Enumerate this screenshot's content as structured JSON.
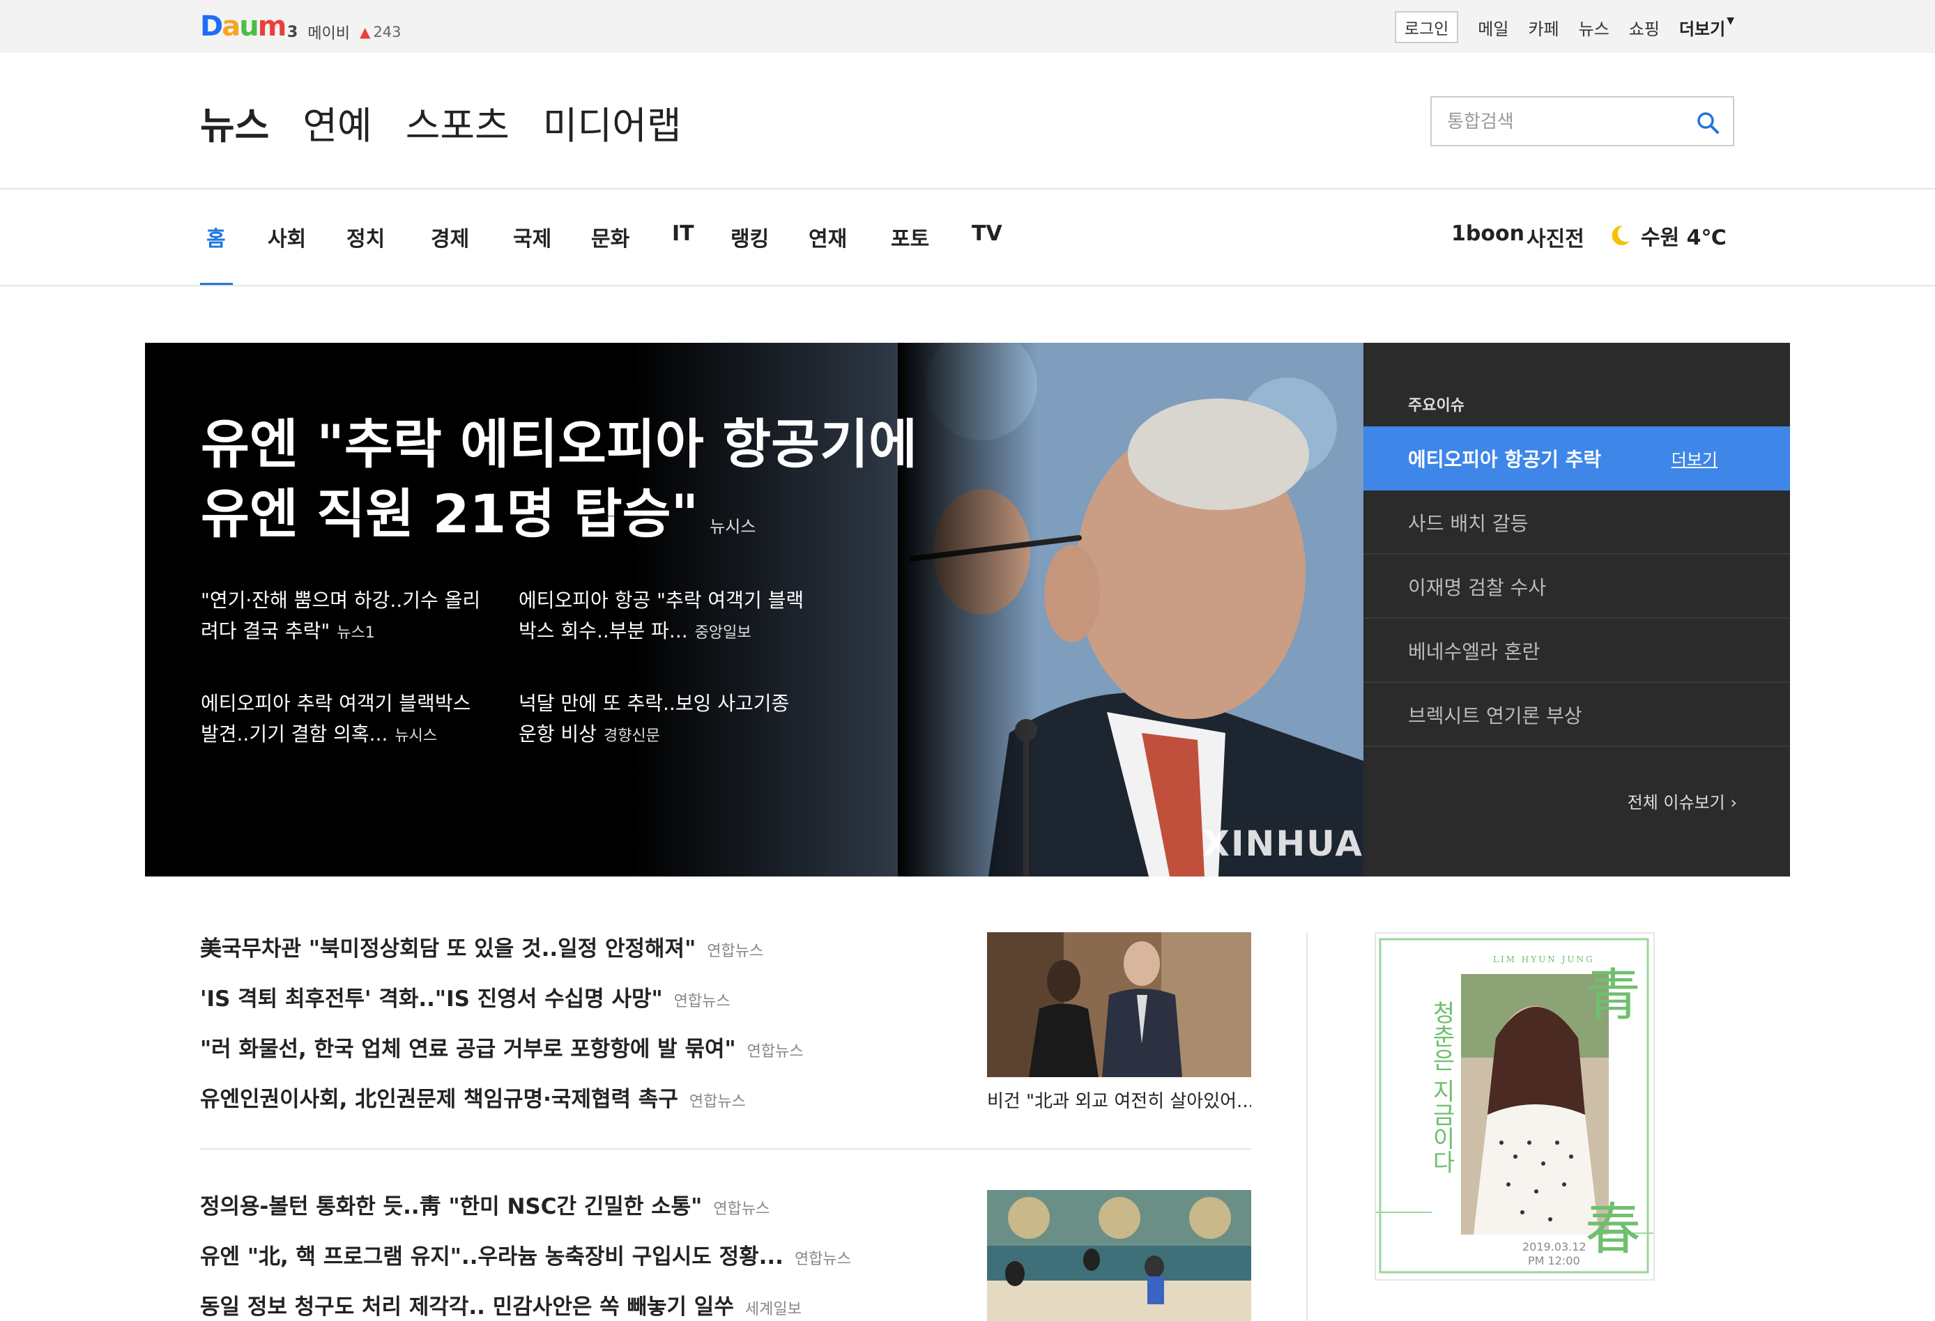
{
  "topbar": {
    "logo_letters": [
      "D",
      "a",
      "u",
      "m"
    ],
    "rank": {
      "number": "3",
      "keyword": "메이비",
      "delta": "243"
    },
    "login": "로그인",
    "links": [
      "메일",
      "카페",
      "뉴스",
      "쇼핑"
    ],
    "more": "더보기"
  },
  "sections": {
    "items": [
      "뉴스",
      "연예",
      "스포츠",
      "미디어랩"
    ],
    "active": "뉴스"
  },
  "search": {
    "placeholder": "통합검색"
  },
  "nav": {
    "categories": [
      "홈",
      "사회",
      "정치",
      "경제",
      "국제",
      "문화",
      "IT",
      "랭킹",
      "연재",
      "포토",
      "TV"
    ],
    "active": "홈",
    "right_links": [
      "1boon",
      "사진전"
    ],
    "weather": "수원 4℃"
  },
  "hero": {
    "title": "유엔 \"추락 에티오피아 항공기에 유엔 직원 21명 탑승\"",
    "title_source": "뉴시스",
    "subs": [
      {
        "text": "\"연기·잔해 뿜으며 하강..기수 올리려다 결국 추락\"",
        "source": "뉴스1"
      },
      {
        "text": "에티오피아 항공 \"추락 여객기 블랙박스 회수..부분 파...",
        "source": "중앙일보"
      },
      {
        "text": "에티오피아 추락 여객기 블랙박스 발견..기기 결함 의혹...",
        "source": "뉴시스"
      },
      {
        "text": "넉달 만에 또 추락..보잉 사고기종 운항 비상",
        "source": "경향신문"
      }
    ],
    "watermark": "XINHUA"
  },
  "issues": {
    "heading": "주요이슈",
    "items": [
      "에티오피아 항공기 추락",
      "사드 배치 갈등",
      "이재명 검찰 수사",
      "베네수엘라 혼란",
      "브렉시트 연기론 부상"
    ],
    "more": "더보기",
    "all": "전체 이슈보기"
  },
  "news": {
    "group1": [
      {
        "text": "美국무차관 \"북미정상회담 또 있을 것..일정 안정해져\"",
        "source": "연합뉴스"
      },
      {
        "text": "'IS 격퇴 최후전투' 격화..\"IS 진영서 수십명 사망\"",
        "source": "연합뉴스"
      },
      {
        "text": "\"러 화물선, 한국 업체 연료 공급 거부로 포항항에 발 묶여\"",
        "source": "연합뉴스"
      },
      {
        "text": "유엔인권이사회, 北인권문제 책임규명·국제협력 촉구",
        "source": "연합뉴스"
      }
    ],
    "group2": [
      {
        "text": "정의용-볼턴 통화한 듯..靑 \"한미 NSC간 긴밀한 소통\"",
        "source": "연합뉴스"
      },
      {
        "text": "유엔 \"北, 핵 프로그램 유지\"..우라늄 농축장비 구입시도 정황...",
        "source": "연합뉴스"
      },
      {
        "text": "동일 정보 청구도 처리 제각각.. 민감사안은 쏙 빼놓기 일쑤",
        "source": "세계일보"
      }
    ],
    "thumb_caption": "비건 \"北과 외교 여전히 살아있어...\""
  },
  "ad": {
    "top": "LIM HYUN JUNG",
    "vertical": "청춘은 지금이다",
    "big1": "青",
    "big2": "春",
    "date": "2019.03.12",
    "time": "PM 12:00"
  },
  "colors": {
    "accent": "#1d74e0",
    "issue_active": "#3e86e8",
    "panel": "#2b2b2b"
  }
}
